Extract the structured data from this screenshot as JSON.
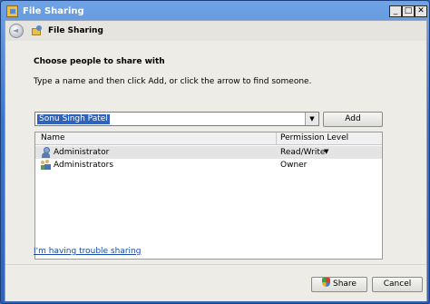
{
  "window": {
    "title": "File Sharing",
    "controls": [
      "_",
      "□",
      "✕"
    ]
  },
  "nav": {
    "title": "File Sharing"
  },
  "main": {
    "heading": "Choose people to share with",
    "instruction": "Type a name and then click Add, or click the arrow to find someone.",
    "name_input": {
      "value": "Sonu Singh Patel"
    },
    "add_label": "Add"
  },
  "list": {
    "columns": [
      "Name",
      "Permission Level"
    ],
    "rows": [
      {
        "name": "Administrator",
        "permission": "Read/Write",
        "has_dropdown": true,
        "selected": true,
        "icon": "user-icon"
      },
      {
        "name": "Administrators",
        "permission": "Owner",
        "has_dropdown": false,
        "selected": false,
        "icon": "user-group-icon"
      }
    ]
  },
  "trouble_link": "I'm having trouble sharing",
  "footer": {
    "share_label": "Share",
    "cancel_label": "Cancel"
  },
  "colors": {
    "title_bar": "#3b74c9",
    "selection": "#2f62b8",
    "link": "#1a4aa8"
  }
}
